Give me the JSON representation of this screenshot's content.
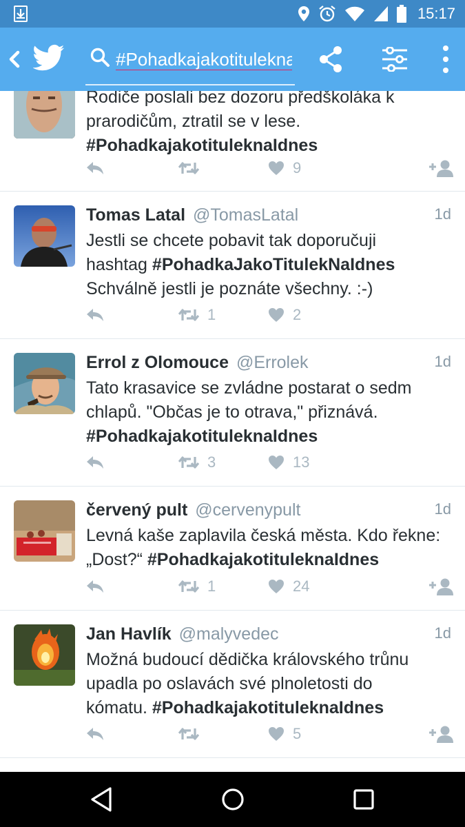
{
  "status_bar": {
    "time": "15:17",
    "icons": [
      "download-notification-icon",
      "location-icon",
      "alarm-icon",
      "wifi-icon",
      "signal-icon",
      "battery-icon"
    ]
  },
  "app_bar": {
    "search_value": "#Pohadkajakotitulekna",
    "icons": [
      "back-arrow-icon",
      "twitter-bird-icon",
      "search-icon",
      "share-icon",
      "filter-icon",
      "more-vertical-icon"
    ]
  },
  "tweets": [
    {
      "name": "",
      "handle": "",
      "time": "",
      "text_partial": "Rodiče poslali bez dozoru předškoláka k",
      "text_lines": [
        "prarodičům, ztratil se v lese."
      ],
      "hashtag": "#PohadkajakotituleknaIdnes",
      "replies": "",
      "retweets": "",
      "likes": "9",
      "follow_icon": true
    },
    {
      "name": "Tomas Latal",
      "handle": "@TomasLatal",
      "time": "1d",
      "line1": "Jestli se chcete pobavit tak doporučuji",
      "line2_prefix": "hashtag ",
      "hashtag": "#PohadkaJakoTitulekNaIdnes",
      "line3": "Schválně jestli je poznáte všechny. :-)",
      "retweets": "1",
      "likes": "2",
      "follow_icon": false
    },
    {
      "name": "Errol z Olomouce",
      "handle": "@Errolek",
      "time": "1d",
      "line1": "Tato krasavice se zvládne postarat o sedm",
      "line2": "chlapů. \"Občas je to otrava,\" přiznává.",
      "hashtag": "#PohadkajakotituleknaIdnes",
      "retweets": "3",
      "likes": "13",
      "follow_icon": false
    },
    {
      "name": "červený pult",
      "handle": "@cervenypult",
      "time": "1d",
      "line1": "Levná kaše zaplavila česká města. Kdo řekne:",
      "line2_prefix": "„Dost?“ ",
      "hashtag": "#PohadkajakotituleknaIdnes",
      "retweets": "1",
      "likes": "24",
      "follow_icon": true
    },
    {
      "name": "Jan Havlík",
      "handle": "@malyvedec",
      "time": "1d",
      "line1": "Možná budoucí dědička královského trůnu",
      "line2": "upadla po oslavách své plnoletosti do",
      "line3_prefix": "kómatu. ",
      "hashtag": "#PohadkajakotituleknaIdnes",
      "retweets": "",
      "likes": "5",
      "follow_icon": true
    }
  ],
  "nav_bar": {
    "icons": [
      "back-triangle-icon",
      "home-circle-icon",
      "recents-square-icon"
    ]
  },
  "colors": {
    "status_bar": "#3e89c7",
    "app_bar": "#55acee",
    "text": "#292f33",
    "secondary_text": "#8899a6",
    "action_icons": "#aab8c2",
    "search_underline": "#e0245e"
  }
}
